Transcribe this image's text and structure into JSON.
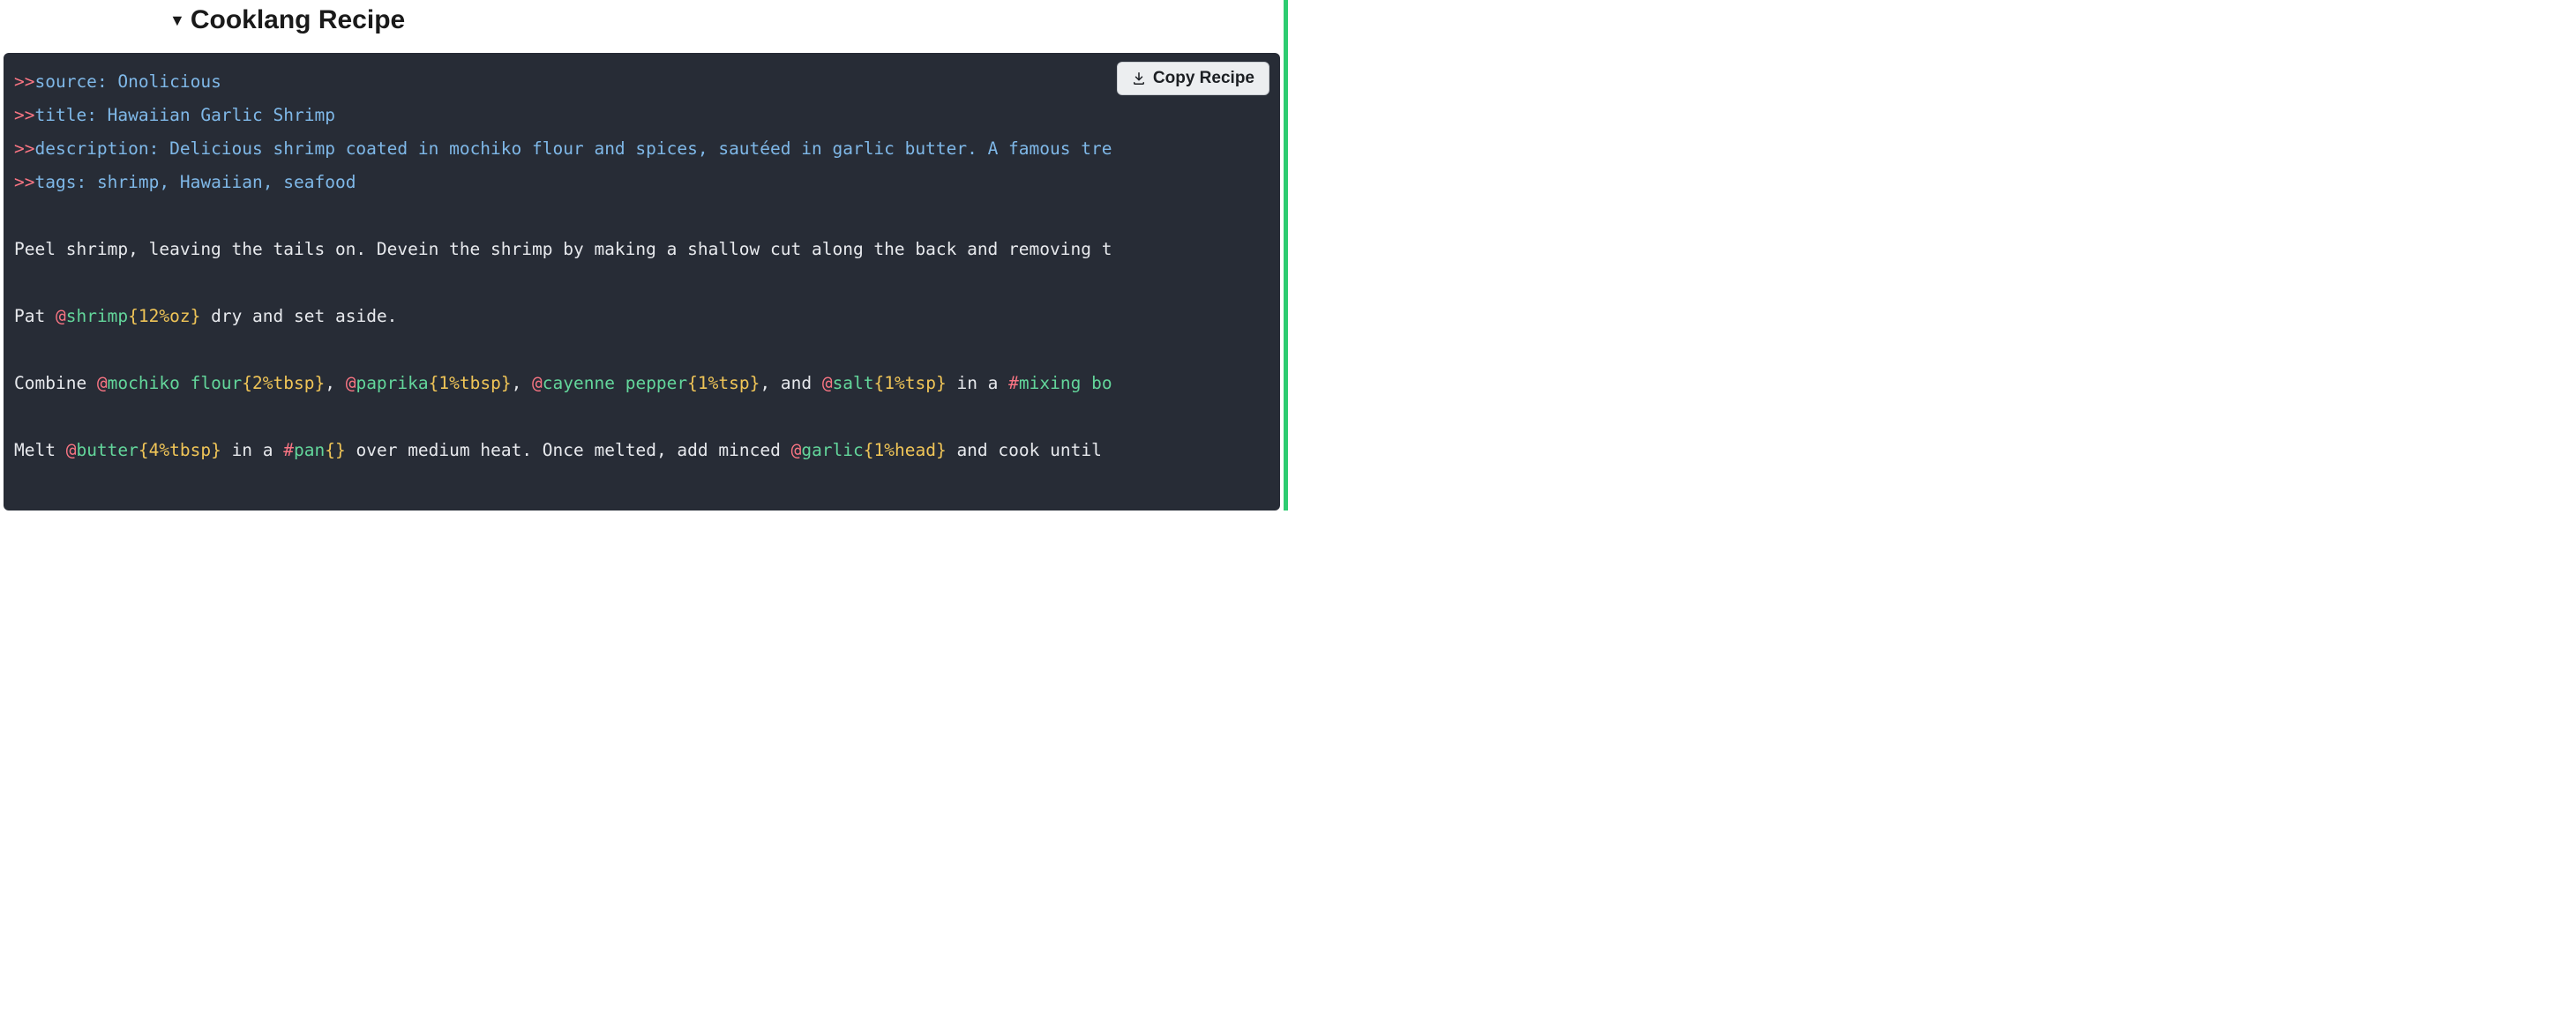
{
  "header": {
    "title": "Cooklang Recipe"
  },
  "copy_button": {
    "label": "Copy Recipe"
  },
  "recipe": {
    "meta": {
      "source": "Onolicious",
      "title": "Hawaiian Garlic Shrimp",
      "description": "Delicious shrimp coated in mochiko flour and spices, sautéed in garlic butter. A famous tre",
      "tags": "shrimp, Hawaiian, seafood"
    },
    "lines": {
      "l1": "Peel shrimp, leaving the tails on. Devein the shrimp by making a shallow cut along the back and removing t",
      "l2_pre": "Pat ",
      "l2_ing1": "shrimp",
      "l2_qty1": "{12%oz}",
      "l2_post": " dry and set aside.",
      "l3_pre": "Combine ",
      "l3_ing1": "mochiko flour",
      "l3_qty1": "{2%tbsp}",
      "l3_sep1": ", ",
      "l3_ing2": "paprika",
      "l3_qty2": "{1%tbsp}",
      "l3_sep2": ", ",
      "l3_ing3": "cayenne pepper",
      "l3_qty3": "{1%tsp}",
      "l3_sep3": ", and ",
      "l3_ing4": "salt",
      "l3_qty4": "{1%tsp}",
      "l3_mid": " in a ",
      "l3_tool": "mixing bo",
      "l4_pre": "Melt ",
      "l4_ing1": "butter",
      "l4_qty1": "{4%tbsp}",
      "l4_mid1": " in a ",
      "l4_tool": "pan",
      "l4_toolqty": "{}",
      "l4_mid2": " over medium heat. Once melted, add minced ",
      "l4_ing2": "garlic",
      "l4_qty2": "{1%head}",
      "l4_post": " and cook until "
    },
    "keys": {
      "source": "source",
      "title": "title",
      "description": "description",
      "tags": "tags"
    },
    "syntax": {
      "meta_prefix": ">>",
      "colon_sp": ": ",
      "at": "@",
      "hash": "#"
    }
  }
}
